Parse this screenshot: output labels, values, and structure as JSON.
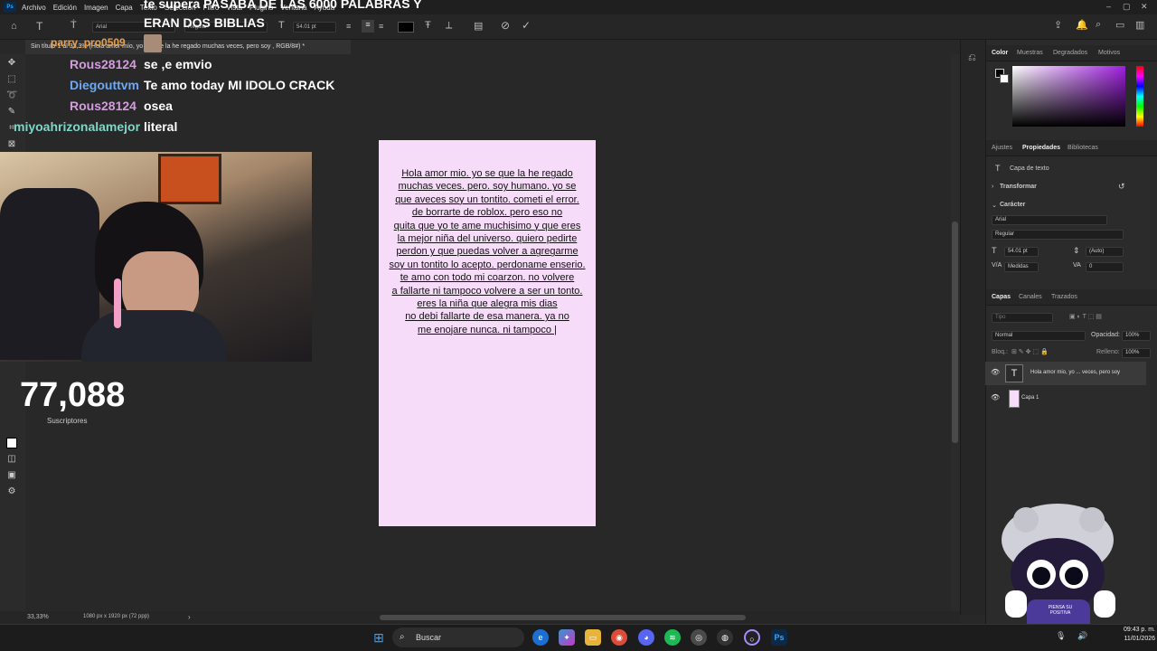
{
  "menu": {
    "app_badge": "Ps",
    "items": [
      "Archivo",
      "Edición",
      "Imagen",
      "Capa",
      "Texto",
      "Selección",
      "Filtro",
      "Vista",
      "Plugins",
      "Ventana",
      "Ayuda"
    ]
  },
  "options_bar": {
    "font_family": "Arial",
    "font_style": "Regular",
    "font_size": "54.01 pt",
    "text_color": "#000000"
  },
  "document_tab": {
    "title": "Sin título-1 al 33,3% (Hola amor mío, yo se que la he regado  muchas veces, pero  soy , RGB/8#) *"
  },
  "canvas": {
    "background": "#f7dcf9",
    "text_lines": [
      "Hola amor mio. yo se que la he regado",
      "muchas veces. pero. soy humano. yo se",
      "que aveces soy un tontito. cometi el error.",
      "de borrarte de roblox. pero eso no",
      "quita que yo te ame muchisimo y que eres",
      "la mejor niña del universo. quiero pedirte",
      "perdon y que puedas volver a agregarme",
      "soy un tontito lo acepto. perdoname enserio.",
      "te amo con todo mi coarzon. no volvere",
      "a fallarte ni tampoco volvere a ser un tonto.",
      "eres la niña que alegra mis dias",
      "no debi fallarte de esa manera. ya no",
      "me enojare nunca. ni tampoco |"
    ]
  },
  "status_bar": {
    "zoom": "33,33%",
    "doc_info": "1080 px x 1920 px (72 ppp)"
  },
  "panels": {
    "color_tabs": [
      "Color",
      "Muestras",
      "Degradados",
      "Motivos"
    ],
    "props_tabs": [
      "Ajustes",
      "Propiedades",
      "Bibliotecas"
    ],
    "props_subtitle": "Capa de texto",
    "transform_label": "Transformar",
    "character_label": "Carácter",
    "font_family": "Arial",
    "font_style": "Regular",
    "font_size": "54.01 pt",
    "leading": "(Auto)",
    "kerning": "Medidas",
    "tracking": "0",
    "layers_tabs": [
      "Capas",
      "Canales",
      "Trazados"
    ],
    "filter_placeholder": "Tipo",
    "blend_mode": "Normal",
    "opacity_label": "Opacidad:",
    "opacity": "100%",
    "lock_label": "Bloq.:",
    "fill_label": "Relleno:",
    "fill": "100%",
    "layers": [
      {
        "name": "Hola amor mio, yo ... veces, pero  soy",
        "type": "text",
        "thumb": "T"
      },
      {
        "name": "Capa 1",
        "type": "pixel",
        "thumb": ""
      }
    ]
  },
  "stream": {
    "top_lines": [
      "te supera PASABA DE LAS 6000 PALABRAS Y",
      "ERAN DOS BIBLIAS"
    ],
    "partial_user": "parry_pro0509",
    "chat": [
      {
        "user": "Rous28124",
        "color": "#d59be0",
        "msg": "se ,e emvio"
      },
      {
        "user": "Diegouttvm",
        "color": "#6fa8f0",
        "msg": "Te amo today MI IDOLO CRACK"
      },
      {
        "user": "Rous28124",
        "color": "#d59be0",
        "msg": "osea"
      },
      {
        "user": "miyoahrizonalamejor",
        "color": "#7fd6c8",
        "msg": "literal"
      }
    ],
    "subscriber_count": "77,088",
    "subscriber_label": "Suscriptores",
    "mascot_text": "PIENSA SU POSITIVA"
  },
  "taskbar": {
    "search_placeholder": "Buscar",
    "time": "09:43 p. m.",
    "date": "11/01/2026"
  }
}
